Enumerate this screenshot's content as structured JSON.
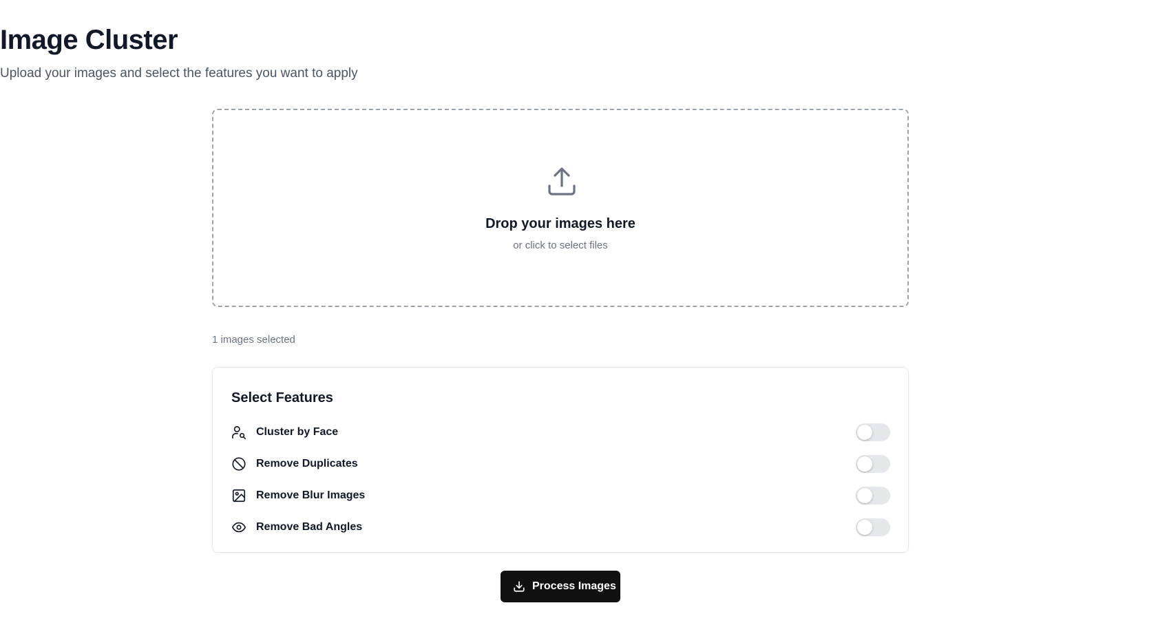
{
  "header": {
    "title": "Image Cluster",
    "subtitle": "Upload your images and select the features you want to apply"
  },
  "dropzone": {
    "icon": "upload-icon",
    "title": "Drop your images here",
    "subtitle": "or click to select files"
  },
  "selection": {
    "count_text": "1 images selected"
  },
  "features": {
    "title": "Select Features",
    "items": [
      {
        "icon": "user-search-icon",
        "label": "Cluster by Face",
        "enabled": false
      },
      {
        "icon": "ban-icon",
        "label": "Remove Duplicates",
        "enabled": false
      },
      {
        "icon": "image-icon",
        "label": "Remove Blur Images",
        "enabled": false
      },
      {
        "icon": "eye-icon",
        "label": "Remove Bad Angles",
        "enabled": false
      }
    ]
  },
  "actions": {
    "process_label": "Process Images",
    "process_icon": "download-icon"
  },
  "colors": {
    "text_primary": "#111827",
    "text_muted": "#6b7280",
    "button_bg": "#111111",
    "toggle_off": "#e5e7eb",
    "dashed_border": "#9ca3af"
  }
}
